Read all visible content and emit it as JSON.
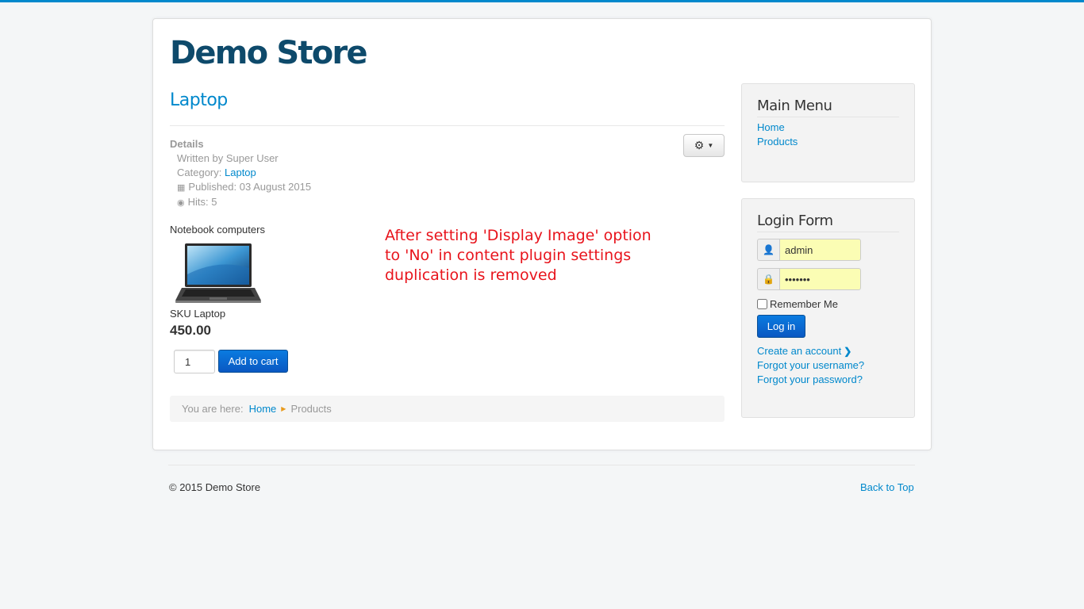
{
  "site": {
    "brand": "Demo Store"
  },
  "article": {
    "title": "Laptop",
    "details_label": "Details",
    "written_by": "Written by Super User",
    "category_label": "Category:",
    "category_link": "Laptop",
    "published": "Published: 03 August 2015",
    "hits": "Hits: 5",
    "gear_icon": "gear-icon"
  },
  "product": {
    "heading": "Notebook computers",
    "sku": "SKU Laptop",
    "price": "450.00",
    "quantity": "1",
    "add_to_cart": "Add to cart"
  },
  "annotation": {
    "line1": "After setting 'Display Image' option",
    "line2": "to 'No' in content plugin settings",
    "line3": "duplication is removed",
    "color": "#e8141c"
  },
  "breadcrumb": {
    "prefix": "You are here:",
    "home": "Home",
    "current": "Products"
  },
  "main_menu": {
    "title": "Main Menu",
    "items": [
      {
        "label": "Home"
      },
      {
        "label": "Products"
      }
    ]
  },
  "login_form": {
    "title": "Login Form",
    "username": "admin",
    "password": "•••••••",
    "remember_label": "Remember Me",
    "login_button": "Log in",
    "create_account": "Create an account",
    "forgot_username": "Forgot your username?",
    "forgot_password": "Forgot your password?"
  },
  "footer": {
    "copyright": "© 2015 Demo Store",
    "back_to_top": "Back to Top"
  },
  "colors": {
    "accent": "#0088cc",
    "brand": "#0e4a6b",
    "button": "#0a6ad1"
  }
}
